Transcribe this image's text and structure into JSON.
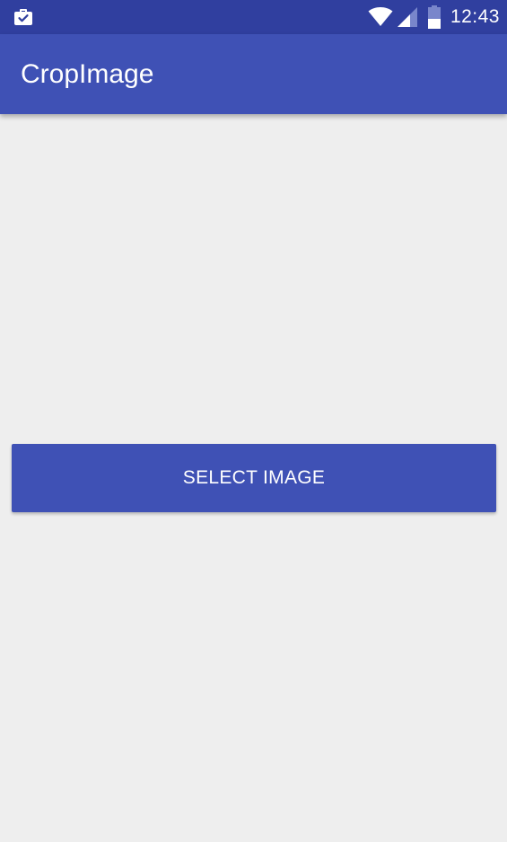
{
  "status_bar": {
    "time": "12:43",
    "icons": {
      "notification": "briefcase-check-icon",
      "wifi": "wifi-icon",
      "signal": "cell-signal-icon",
      "battery": "battery-icon"
    },
    "background_color": "#303f9f"
  },
  "app_bar": {
    "title": "CropImage",
    "background_color": "#3f51b5"
  },
  "main": {
    "select_button_label": "SELECT IMAGE",
    "button_color": "#3f51b5",
    "background_color": "#eeeeee"
  }
}
